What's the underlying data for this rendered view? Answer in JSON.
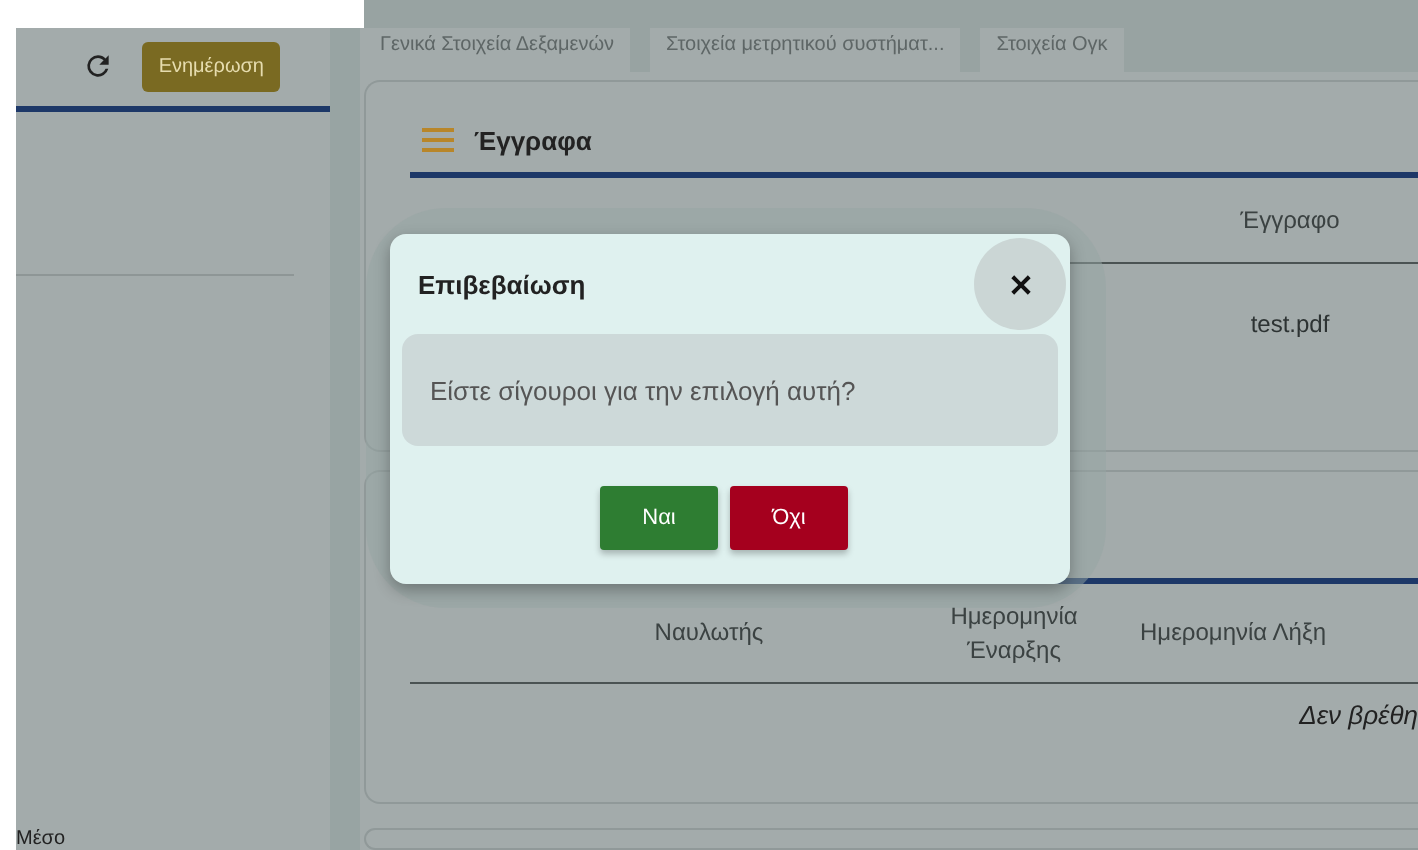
{
  "sidebar": {
    "update_button": "Ενημέρωση",
    "footer_label": "Μέσο"
  },
  "tabs": [
    {
      "label": "Γενικά Στοιχεία Δεξαμενών",
      "selected": false
    },
    {
      "label": "Στοιχεία μετρητικού συστήματ...",
      "selected": false
    },
    {
      "label": "Στοιχεία Ογκ",
      "selected": false
    }
  ],
  "documents_card": {
    "title": "Έγγραφα",
    "columns": [
      "",
      "",
      "Έγγραφο"
    ],
    "rows": [
      [
        "",
        "",
        "test.pdf"
      ]
    ]
  },
  "charterers_card": {
    "columns": [
      "Ναυλωτής",
      "Ημερομηνία Έναρξης",
      "Ημερομηνία Λήξη"
    ],
    "empty_message": "Δεν βρέθη"
  },
  "dialog": {
    "title": "Επιβεβαίωση",
    "message": "Είστε σίγουροι για την επιλογή αυτή?",
    "buttons": [
      {
        "label": "Ναι",
        "kind": "confirm"
      },
      {
        "label": "Όχι",
        "kind": "cancel"
      }
    ]
  }
}
